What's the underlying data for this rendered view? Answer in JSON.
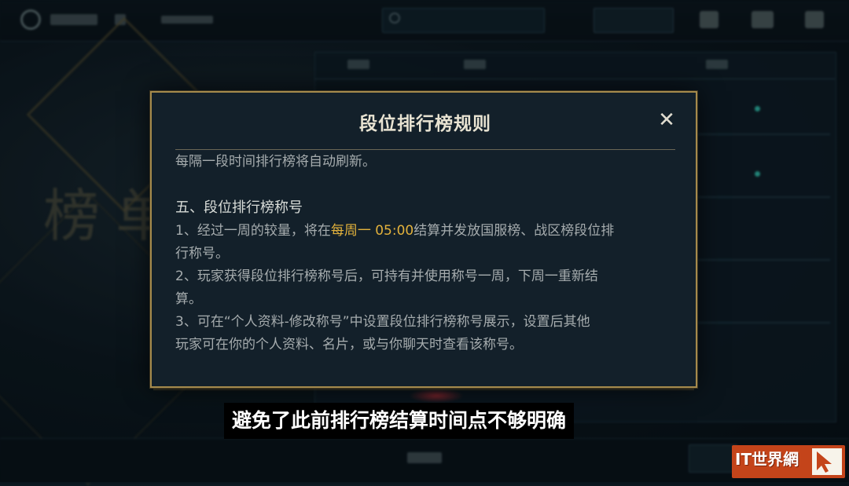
{
  "dialog": {
    "title": "段位排行榜规则",
    "close_symbol": "✕",
    "lines": {
      "intro": "每隔一段时间排行榜将自动刷新。",
      "section_heading": "五、段位排行榜称号",
      "item1_prefix": "1、经过一周的较量，将在",
      "item1_highlight": "每周一 05:00",
      "item1_suffix": "结算并发放国服榜、战区榜段位排",
      "item1_cont": "行称号。",
      "item2": "2、玩家获得段位排行榜称号后，可持有并使用称号一周，下周一重新结",
      "item2_cont": "算。",
      "item3": "3、可在“个人资料-修改称号”中设置段位排行榜称号展示，设置后其他",
      "item3_cont": "玩家可在你的个人资料、名片，或与你聊天时查看该称号。"
    }
  },
  "subtitle": "避免了此前排行榜结算时间点不够明确",
  "watermark": {
    "text": "IT世界網",
    "icon": "cursor-arrow-icon"
  },
  "colors": {
    "dialog_border": "#a58a4c",
    "highlight": "#e3b23c",
    "dialog_bg": "#13202a",
    "watermark_bg": "#c4441a"
  }
}
